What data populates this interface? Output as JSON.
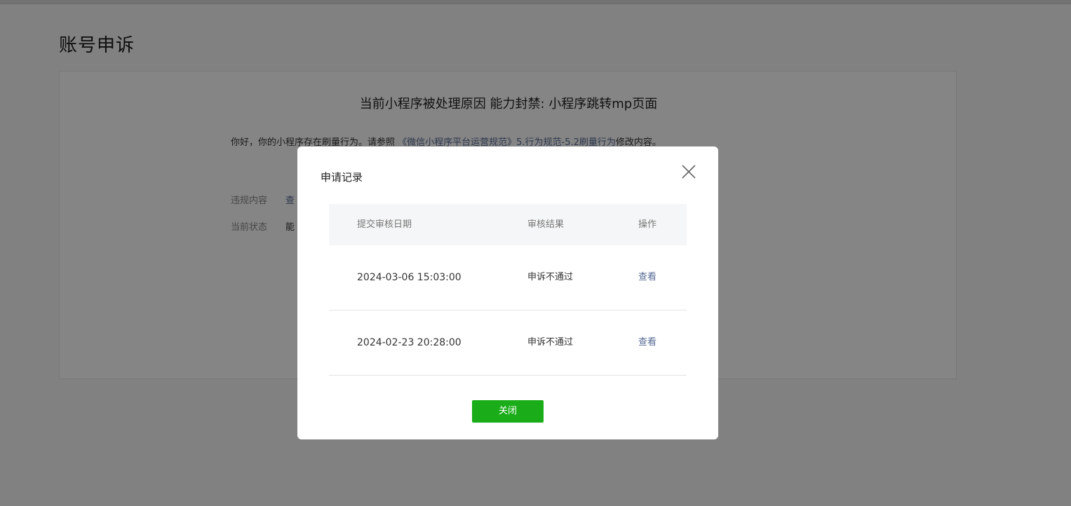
{
  "page": {
    "title": "账号申诉"
  },
  "card": {
    "reason_title": "当前小程序被处理原因 能力封禁: 小程序跳转mp页面",
    "notice_prefix": "你好，你的小程序存在刷量行为。请参照 ",
    "notice_link": "《微信小程序平台运营规范》5.行为规范-5.2刷量行为",
    "notice_suffix": "修改内容。",
    "violation_label": "违规内容",
    "violation_value": "查",
    "status_label": "当前状态",
    "status_value": "能"
  },
  "dialog": {
    "title": "申请记录",
    "close_icon": "close-icon",
    "columns": [
      "提交审核日期",
      "审核结果",
      "操作"
    ],
    "rows": [
      {
        "date": "2024-03-06 15:03:00",
        "result": "申诉不通过",
        "action": "查看"
      },
      {
        "date": "2024-02-23 20:28:00",
        "result": "申诉不通过",
        "action": "查看"
      }
    ],
    "close_button": "关闭"
  },
  "colors": {
    "accent_green": "#1aad19",
    "link_blue": "#576b95",
    "overlay": "rgba(0,0,0,0.48)"
  }
}
